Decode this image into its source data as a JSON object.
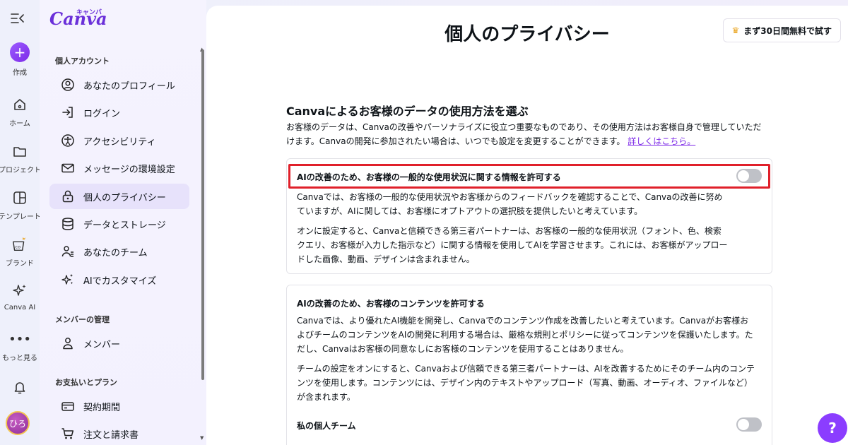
{
  "rail": {
    "create": "作成",
    "home": "ホーム",
    "projects": "プロジェクト",
    "templates": "テンプレート",
    "brand": "ブランド",
    "canva_ai": "Canva AI",
    "more": "もっと見る",
    "avatar_initials": "ひろ"
  },
  "panel": {
    "logo": "Canva",
    "logo_kana": "キャンバ",
    "group_personal": "個人アカウント",
    "items": [
      {
        "label": "あなたのプロフィール",
        "icon": "profile-icon"
      },
      {
        "label": "ログイン",
        "icon": "login-icon"
      },
      {
        "label": "アクセシビリティ",
        "icon": "accessibility-icon"
      },
      {
        "label": "メッセージの環境設定",
        "icon": "envelope-icon"
      },
      {
        "label": "個人のプライバシー",
        "icon": "lock-icon"
      },
      {
        "label": "データとストレージ",
        "icon": "database-icon"
      },
      {
        "label": "あなたのチーム",
        "icon": "team-icon"
      },
      {
        "label": "AIでカスタマイズ",
        "icon": "sparkle-icon"
      }
    ],
    "group_members": "メンバーの管理",
    "members_item": "メンバー",
    "group_billing": "お支払いとプラン",
    "billing_items": [
      "契約期間",
      "注文と請求書"
    ]
  },
  "main": {
    "title": "個人のプライバシー",
    "trial_button": "まず30日間無料で試す",
    "section_title": "Canvaによるお客様のデータの使用方法を選ぶ",
    "section_desc": "お客様のデータは、Canvaの改善やパーソナライズに役立つ重要なものであり、その使用方法はお客様自身で管理していただけます。Canvaの開発に参加されたい場合は、いつでも設定を変更することができます。",
    "learn_more": "詳しくはこちら。",
    "card1": {
      "title": "AIの改善のため、お客様の一般的な使用状況に関する情報を許可する",
      "p1": "Canvaでは、お客様の一般的な使用状況やお客様からのフィードバックを確認することで、Canvaの改善に努めていますが、AIに関しては、お客様にオプトアウトの選択肢を提供したいと考えています。",
      "p2": "オンに設定すると、Canvaと信頼できる第三者パートナーは、お客様の一般的な使用状況（フォント、色、検索クエリ、お客様が入力した指示など）に関する情報を使用してAIを学習させます。これには、お客様がアップロードした画像、動画、デザインは含まれません。",
      "enabled": false
    },
    "card2": {
      "title": "AIの改善のため、お客様のコンテンツを許可する",
      "p1": "Canvaでは、より優れたAI機能を開発し、Canvaでのコンテンツ作成を改善したいと考えています。Canvaがお客様およびチームのコンテンツをAIの開発に利用する場合は、厳格な規則とポリシーに従ってコンテンツを保護いたします。ただし、Canvaはお客様の同意なしにお客様のコンテンツを使用することはありません。",
      "p2": "チームの設定をオンにすると、Canvaおよび信頼できる第三者パートナーは、AIを改善するためにそのチーム内のコンテンツを使用します。コンテンツには、デザイン内のテキストやアップロード（写真、動画、オーディオ、ファイルなど）が含まれます。",
      "team_label": "私の個人チーム",
      "team_enabled": false
    },
    "help": "?"
  },
  "colors": {
    "accent": "#7d2ae8",
    "highlight": "#e0202a",
    "toggle_off": "#bfc1c7"
  }
}
